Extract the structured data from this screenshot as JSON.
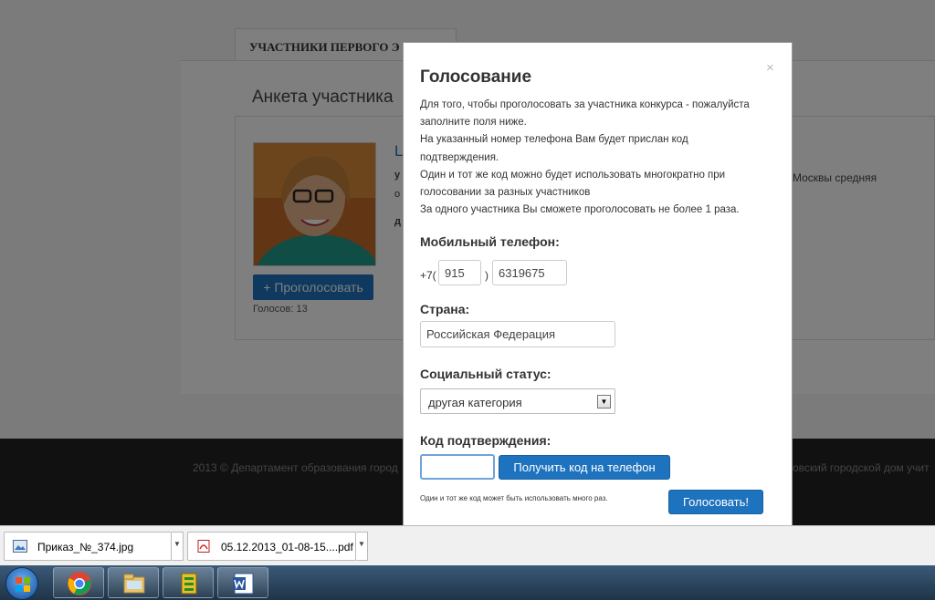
{
  "background_page": {
    "tab_label": "УЧАСТНИКИ ПЕРВОГО Э",
    "anketa_title": "Анкета участника",
    "participant_name_fragment": "L",
    "info_fragment_1": "у",
    "info_fragment_2": "о",
    "info_fragment_3": "д",
    "info_snippet": "Москвы средняя",
    "vote_button": "+ Проголосовать",
    "votes_count": "Голосов: 13",
    "footer_left": "2013 © Департамент образования город",
    "footer_right": "овский городской дом учит"
  },
  "modal": {
    "close_symbol": "×",
    "title": "Голосование",
    "intro_lines": [
      "Для того, чтобы проголосовать за участника конкурса - пожалуйста",
      "заполните поля ниже.",
      "На указанный номер телефона Вам будет прислан код",
      "подтверждения.",
      "Один и тот же код можно будет использовать многократно при",
      "голосовании за разных участников",
      "За одного участника Вы сможете проголосовать не более 1 раза."
    ],
    "phone": {
      "label": "Мобильный телефон:",
      "prefix": "+7(",
      "close_paren": ")",
      "area_code": "915",
      "number": "6319675"
    },
    "country": {
      "label": "Страна:",
      "value": "Российская Федерация"
    },
    "social_status": {
      "label": "Социальный статус:",
      "selected": "другая категория"
    },
    "confirmation": {
      "label": "Код подтверждения:",
      "value": "",
      "get_code_button": "Получить код на телефон",
      "note": "Один и тот же код может быть использовать много раз.",
      "submit_button": "Голосовать!"
    }
  },
  "downloads": [
    {
      "name": "Приказ_№_374.jpg",
      "icon": "image-file-icon"
    },
    {
      "name": "05.12.2013_01-08-15....pdf",
      "icon": "pdf-file-icon"
    }
  ],
  "taskbar": {
    "items": [
      "start-button",
      "chrome-icon",
      "file-explorer-icon",
      "app-icon",
      "word-icon"
    ]
  },
  "colors": {
    "accent": "#1e73be",
    "overlay": "#000000",
    "footer": "#222222",
    "taskbar": "#2a4560"
  }
}
